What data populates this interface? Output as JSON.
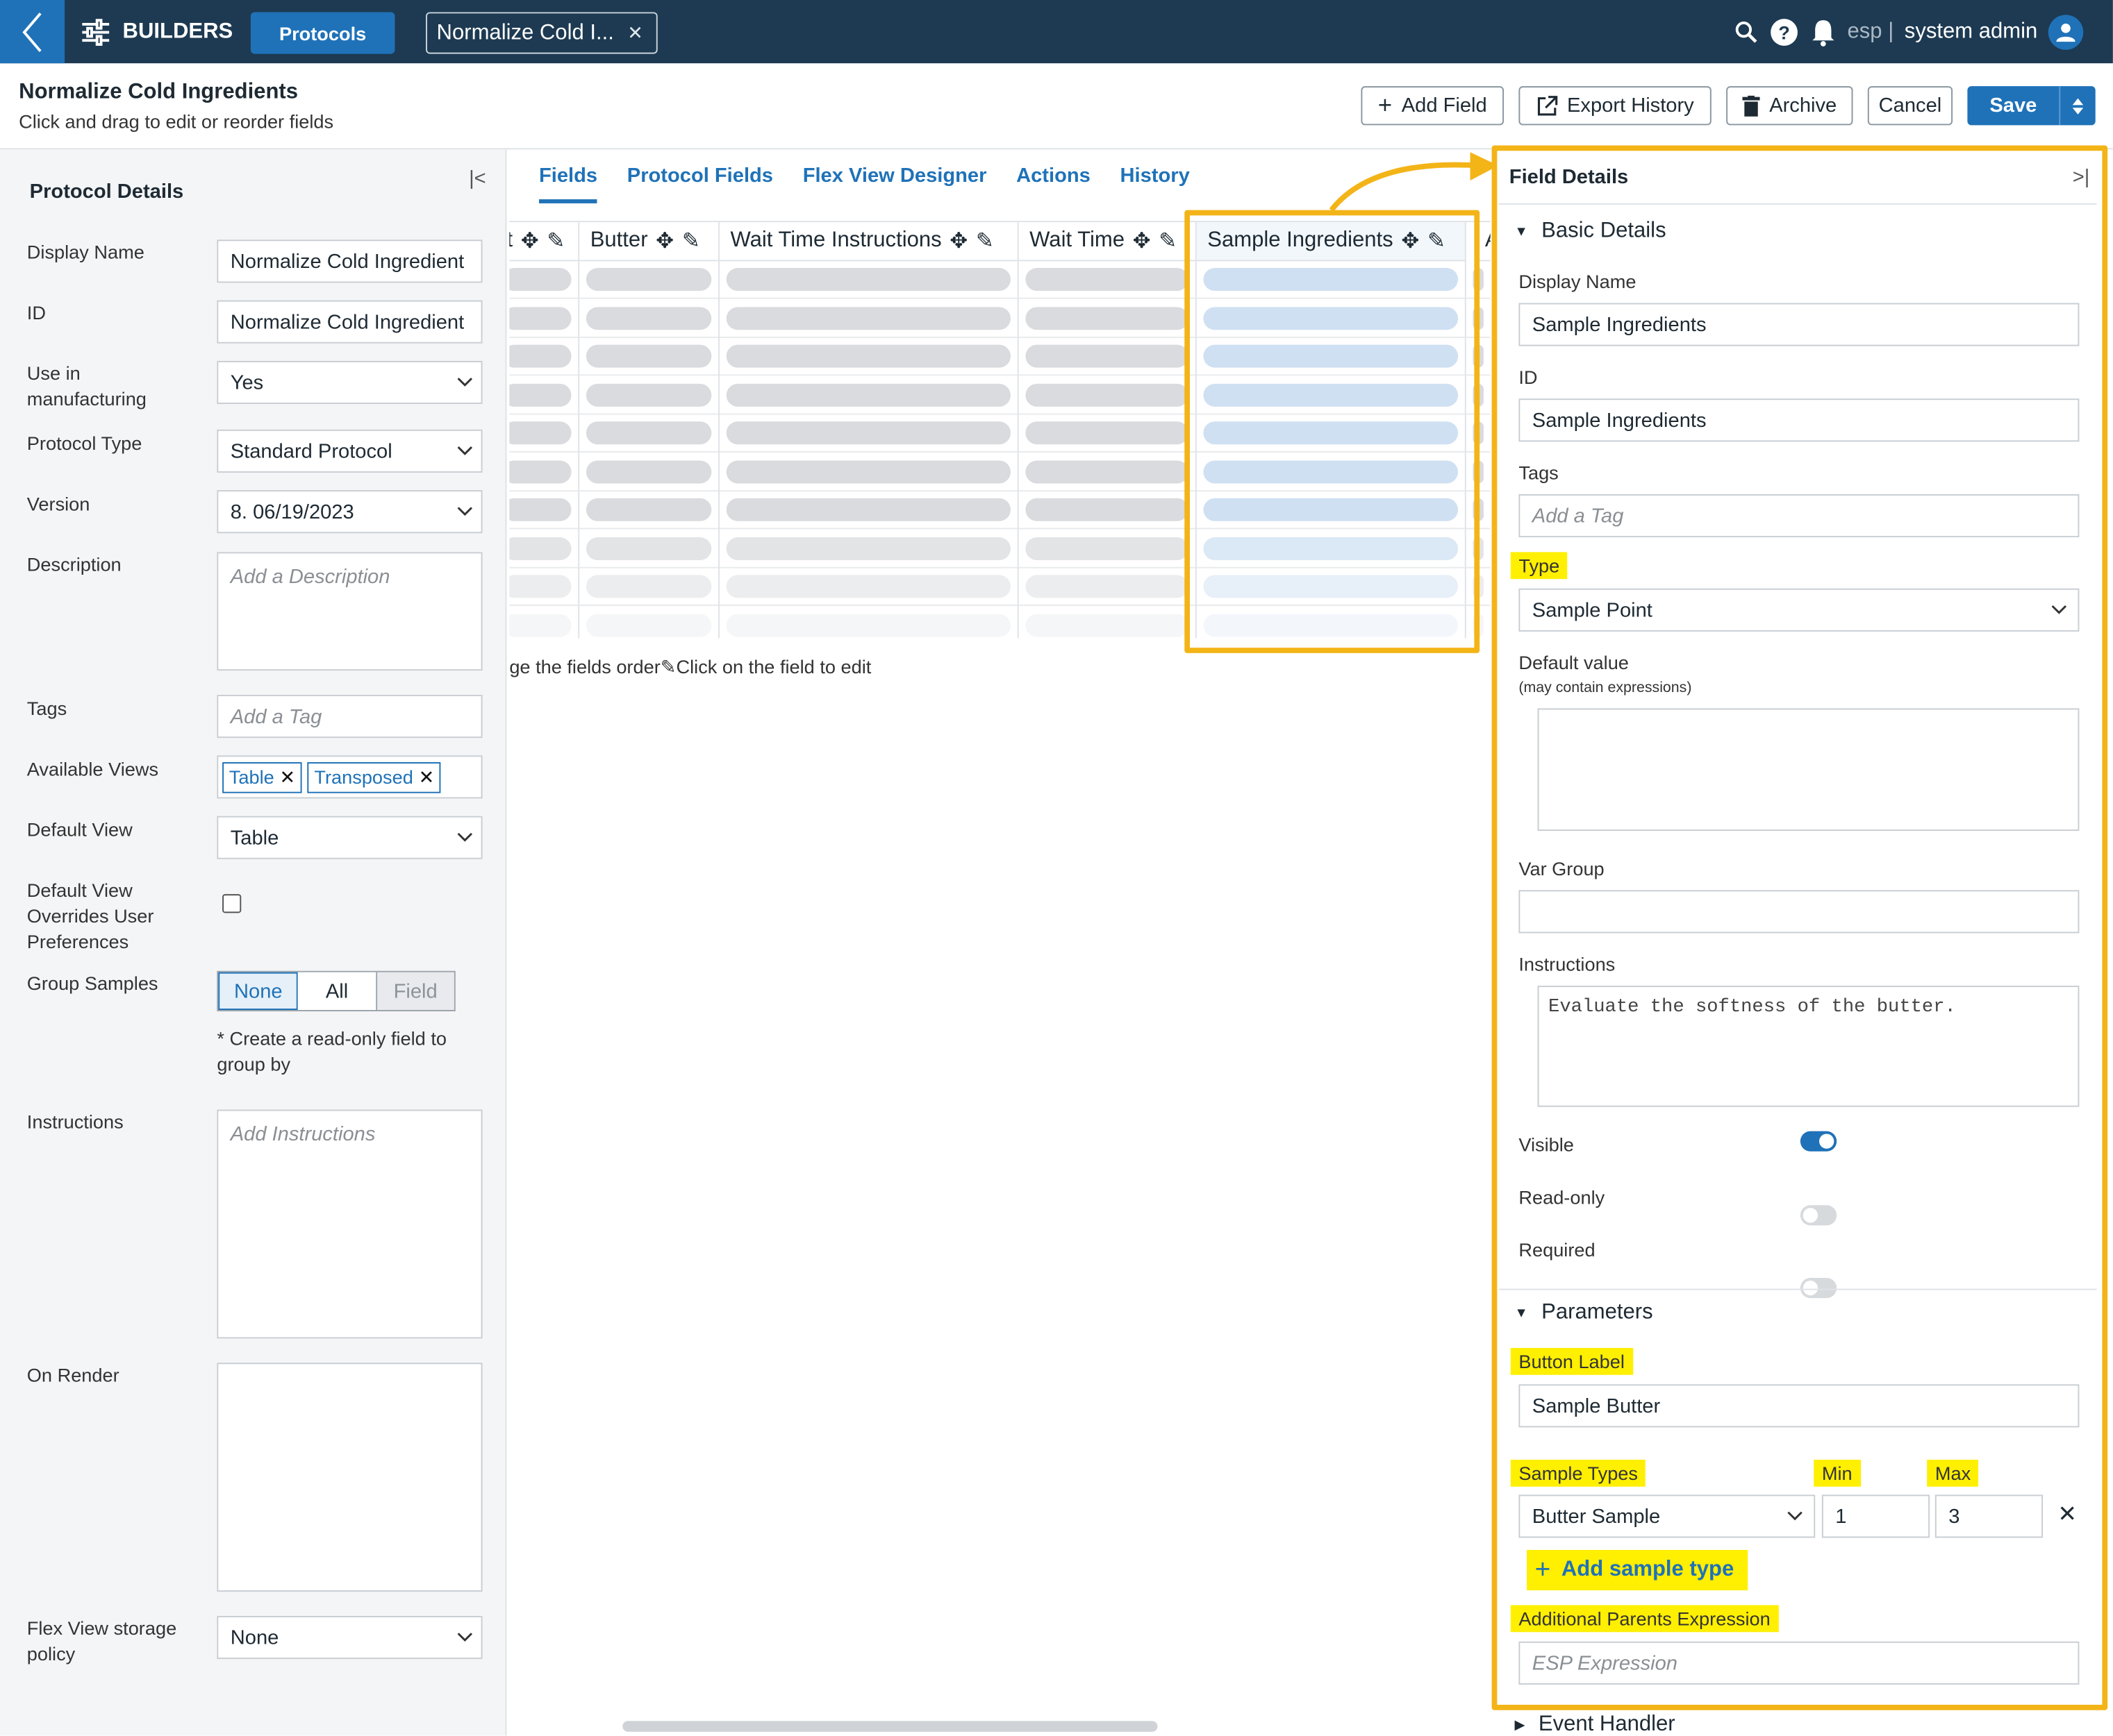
{
  "topbar": {
    "app_title": "BUILDERS",
    "protocols_button": "Protocols",
    "open_tab": "Normalize Cold I...",
    "env": "esp |",
    "user": "system admin"
  },
  "page": {
    "title": "Normalize Cold Ingredients",
    "subtitle": "Click and drag to edit or reorder fields"
  },
  "toolbar": {
    "add_field": "Add Field",
    "export_history": "Export History",
    "archive": "Archive",
    "cancel": "Cancel",
    "save": "Save"
  },
  "left_panel": {
    "title": "Protocol Details",
    "display_name_label": "Display Name",
    "display_name": "Normalize Cold Ingredient",
    "id_label": "ID",
    "id": "Normalize Cold Ingredient",
    "use_in_mfg_label_1": "Use in",
    "use_in_mfg_label_2": "manufacturing",
    "use_in_mfg": "Yes",
    "protocol_type_label": "Protocol Type",
    "protocol_type": "Standard Protocol",
    "version_label": "Version",
    "version": "8. 06/19/2023",
    "description_label": "Description",
    "description_placeholder": "Add a Description",
    "tags_label": "Tags",
    "tags_placeholder": "Add a Tag",
    "views_label": "Available Views",
    "views": [
      "Table",
      "Transposed"
    ],
    "default_view_label": "Default View",
    "default_view": "Table",
    "override_label_1": "Default View",
    "override_label_2": "Overrides User",
    "override_label_3": "Preferences",
    "group_label": "Group Samples",
    "group_options": [
      "None",
      "All",
      "Field"
    ],
    "group_note_1": "* Create a read-only field to",
    "group_note_2": "group by",
    "instructions_label": "Instructions",
    "instructions_placeholder": "Add Instructions",
    "on_render_label": "On Render",
    "flex_label_1": "Flex View storage",
    "flex_label_2": "policy",
    "flex_policy": "None"
  },
  "tabs": [
    "Fields",
    "Protocol Fields",
    "Flex View Designer",
    "Actions",
    "History"
  ],
  "grid": {
    "columns": [
      "t",
      "Butter",
      "Wait Time Instructions",
      "Wait Time",
      "Sample Ingredients",
      "A"
    ],
    "note": "ge the fields order",
    "note2": "Click on the field to edit"
  },
  "right_panel": {
    "title": "Field Details",
    "basic_section": "Basic Details",
    "display_name_label": "Display Name",
    "display_name": "Sample Ingredients",
    "id_label": "ID",
    "id": "Sample Ingredients",
    "tags_label": "Tags",
    "tags_placeholder": "Add a Tag",
    "type_label": "Type",
    "type": "Sample Point",
    "default_label": "Default value",
    "default_sub": "(may contain expressions)",
    "var_group_label": "Var Group",
    "instructions_label": "Instructions",
    "instructions": "Evaluate the softness of the butter.",
    "visible_label": "Visible",
    "readonly_label": "Read-only",
    "required_label": "Required",
    "params_section": "Parameters",
    "button_label_label": "Button Label",
    "button_label": "Sample Butter",
    "sample_types_label": "Sample Types",
    "min_label": "Min",
    "max_label": "Max",
    "sample_type": "Butter Sample",
    "min": "1",
    "max": "3",
    "add_sample_type": "Add sample type",
    "parents_label": "Additional Parents Expression",
    "parents_placeholder": "ESP Expression",
    "event_section": "Event Handler"
  },
  "colors": {
    "navbar": "#1d3a52",
    "accent": "#1f72b8",
    "highlight": "#ffef00",
    "callout": "#f3b417"
  }
}
